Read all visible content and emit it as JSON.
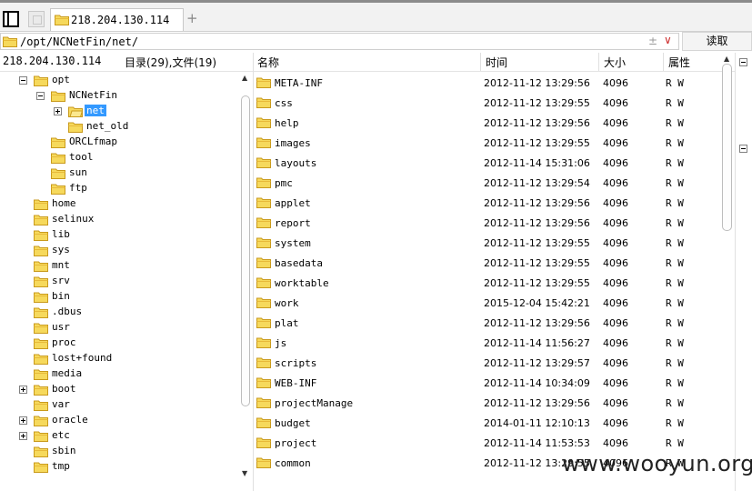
{
  "tab": {
    "label": "218.204.130.114"
  },
  "address": {
    "path": "/opt/NCNetFin/net/",
    "plus_minus": "±",
    "dropdown": "∨",
    "read_button": "读取"
  },
  "header": {
    "server": "218.204.130.114",
    "summary": "目录(29),文件(19)",
    "col_name": "名称",
    "col_time": "时间",
    "col_size": "大小",
    "col_attr": "属性"
  },
  "tree": [
    {
      "label": "opt",
      "depth": 1,
      "toggle": "minus"
    },
    {
      "label": "NCNetFin",
      "depth": 2,
      "toggle": "minus"
    },
    {
      "label": "net",
      "depth": 3,
      "toggle": "plus",
      "selected": true
    },
    {
      "label": "net_old",
      "depth": 3,
      "toggle": "none"
    },
    {
      "label": "ORCLfmap",
      "depth": 2,
      "toggle": "none"
    },
    {
      "label": "tool",
      "depth": 2,
      "toggle": "none"
    },
    {
      "label": "sun",
      "depth": 2,
      "toggle": "none"
    },
    {
      "label": "ftp",
      "depth": 2,
      "toggle": "none"
    },
    {
      "label": "home",
      "depth": 1,
      "toggle": "none"
    },
    {
      "label": "selinux",
      "depth": 1,
      "toggle": "none"
    },
    {
      "label": "lib",
      "depth": 1,
      "toggle": "none"
    },
    {
      "label": "sys",
      "depth": 1,
      "toggle": "none"
    },
    {
      "label": "mnt",
      "depth": 1,
      "toggle": "none"
    },
    {
      "label": "srv",
      "depth": 1,
      "toggle": "none"
    },
    {
      "label": "bin",
      "depth": 1,
      "toggle": "none"
    },
    {
      "label": ".dbus",
      "depth": 1,
      "toggle": "none"
    },
    {
      "label": "usr",
      "depth": 1,
      "toggle": "none"
    },
    {
      "label": "proc",
      "depth": 1,
      "toggle": "none"
    },
    {
      "label": "lost+found",
      "depth": 1,
      "toggle": "none"
    },
    {
      "label": "media",
      "depth": 1,
      "toggle": "none"
    },
    {
      "label": "boot",
      "depth": 1,
      "toggle": "plus"
    },
    {
      "label": "var",
      "depth": 1,
      "toggle": "none"
    },
    {
      "label": "oracle",
      "depth": 1,
      "toggle": "plus"
    },
    {
      "label": "etc",
      "depth": 1,
      "toggle": "plus"
    },
    {
      "label": "sbin",
      "depth": 1,
      "toggle": "none"
    },
    {
      "label": "tmp",
      "depth": 1,
      "toggle": "none"
    }
  ],
  "files": [
    {
      "name": "META-INF",
      "time": "2012-11-12 13:29:56",
      "size": "4096",
      "attr": "R W"
    },
    {
      "name": "css",
      "time": "2012-11-12 13:29:55",
      "size": "4096",
      "attr": "R W"
    },
    {
      "name": "help",
      "time": "2012-11-12 13:29:56",
      "size": "4096",
      "attr": "R W"
    },
    {
      "name": "images",
      "time": "2012-11-12 13:29:55",
      "size": "4096",
      "attr": "R W"
    },
    {
      "name": "layouts",
      "time": "2012-11-14 15:31:06",
      "size": "4096",
      "attr": "R W"
    },
    {
      "name": "pmc",
      "time": "2012-11-12 13:29:54",
      "size": "4096",
      "attr": "R W"
    },
    {
      "name": "applet",
      "time": "2012-11-12 13:29:56",
      "size": "4096",
      "attr": "R W"
    },
    {
      "name": "report",
      "time": "2012-11-12 13:29:56",
      "size": "4096",
      "attr": "R W"
    },
    {
      "name": "system",
      "time": "2012-11-12 13:29:55",
      "size": "4096",
      "attr": "R W"
    },
    {
      "name": "basedata",
      "time": "2012-11-12 13:29:55",
      "size": "4096",
      "attr": "R W"
    },
    {
      "name": "worktable",
      "time": "2012-11-12 13:29:55",
      "size": "4096",
      "attr": "R W"
    },
    {
      "name": "work",
      "time": "2015-12-04 15:42:21",
      "size": "4096",
      "attr": "R W"
    },
    {
      "name": "plat",
      "time": "2012-11-12 13:29:56",
      "size": "4096",
      "attr": "R W"
    },
    {
      "name": "js",
      "time": "2012-11-14 11:56:27",
      "size": "4096",
      "attr": "R W"
    },
    {
      "name": "scripts",
      "time": "2012-11-12 13:29:57",
      "size": "4096",
      "attr": "R W"
    },
    {
      "name": "WEB-INF",
      "time": "2012-11-14 10:34:09",
      "size": "4096",
      "attr": "R W"
    },
    {
      "name": "projectManage",
      "time": "2012-11-12 13:29:56",
      "size": "4096",
      "attr": "R W"
    },
    {
      "name": "budget",
      "time": "2014-01-11 12:10:13",
      "size": "4096",
      "attr": "R W"
    },
    {
      "name": "project",
      "time": "2012-11-14 11:53:53",
      "size": "4096",
      "attr": "R W"
    },
    {
      "name": "common",
      "time": "2012-11-12 13:29:55",
      "size": "4096",
      "attr": "R W"
    }
  ],
  "watermark": "www.wooyun.org",
  "icons": {
    "folder": "folder-icon",
    "expand": "plus-icon",
    "collapse": "minus-icon"
  },
  "colors": {
    "folder_fill": "#f6d95c",
    "folder_edge": "#c99a1c",
    "selection": "#3399ff"
  }
}
